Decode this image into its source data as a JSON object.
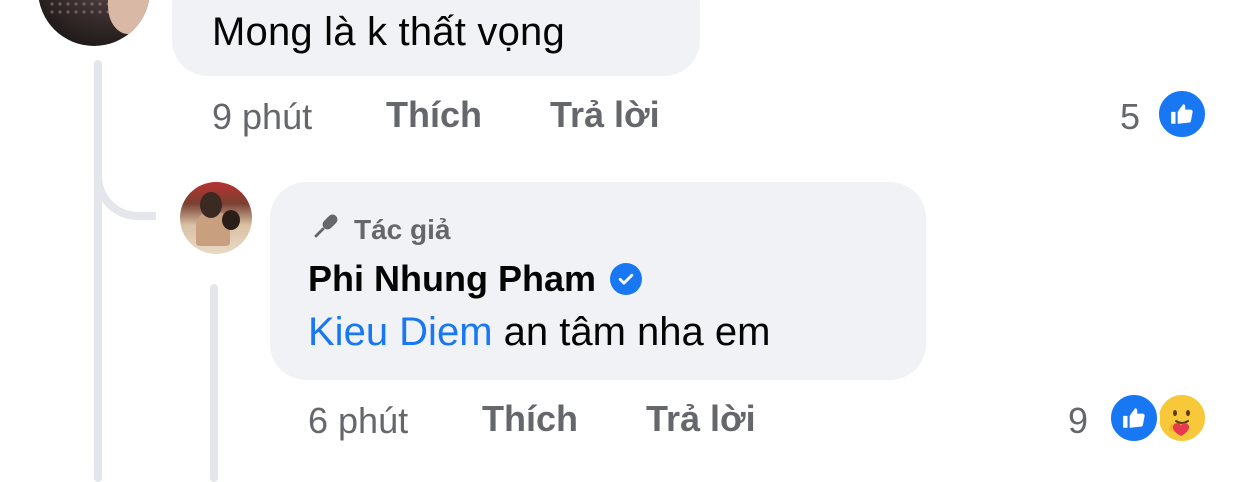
{
  "comment1": {
    "text": "Mong là k thất vọng",
    "time": "9 phút",
    "like_label": "Thích",
    "reply_label": "Trả lời",
    "reaction_count": "5"
  },
  "comment2": {
    "author_badge": "Tác giả",
    "author_name": "Phi Nhung Pham",
    "mention": "Kieu Diem",
    "text": "an tâm nha em",
    "time": "6 phút",
    "like_label": "Thích",
    "reply_label": "Trả lời",
    "reaction_count": "9"
  },
  "colors": {
    "brand_blue": "#1877f2",
    "bubble_bg": "#f0f2f5",
    "meta_gray": "#65676b"
  },
  "icons": [
    "like-icon",
    "care-icon",
    "microphone-icon",
    "verified-icon"
  ]
}
